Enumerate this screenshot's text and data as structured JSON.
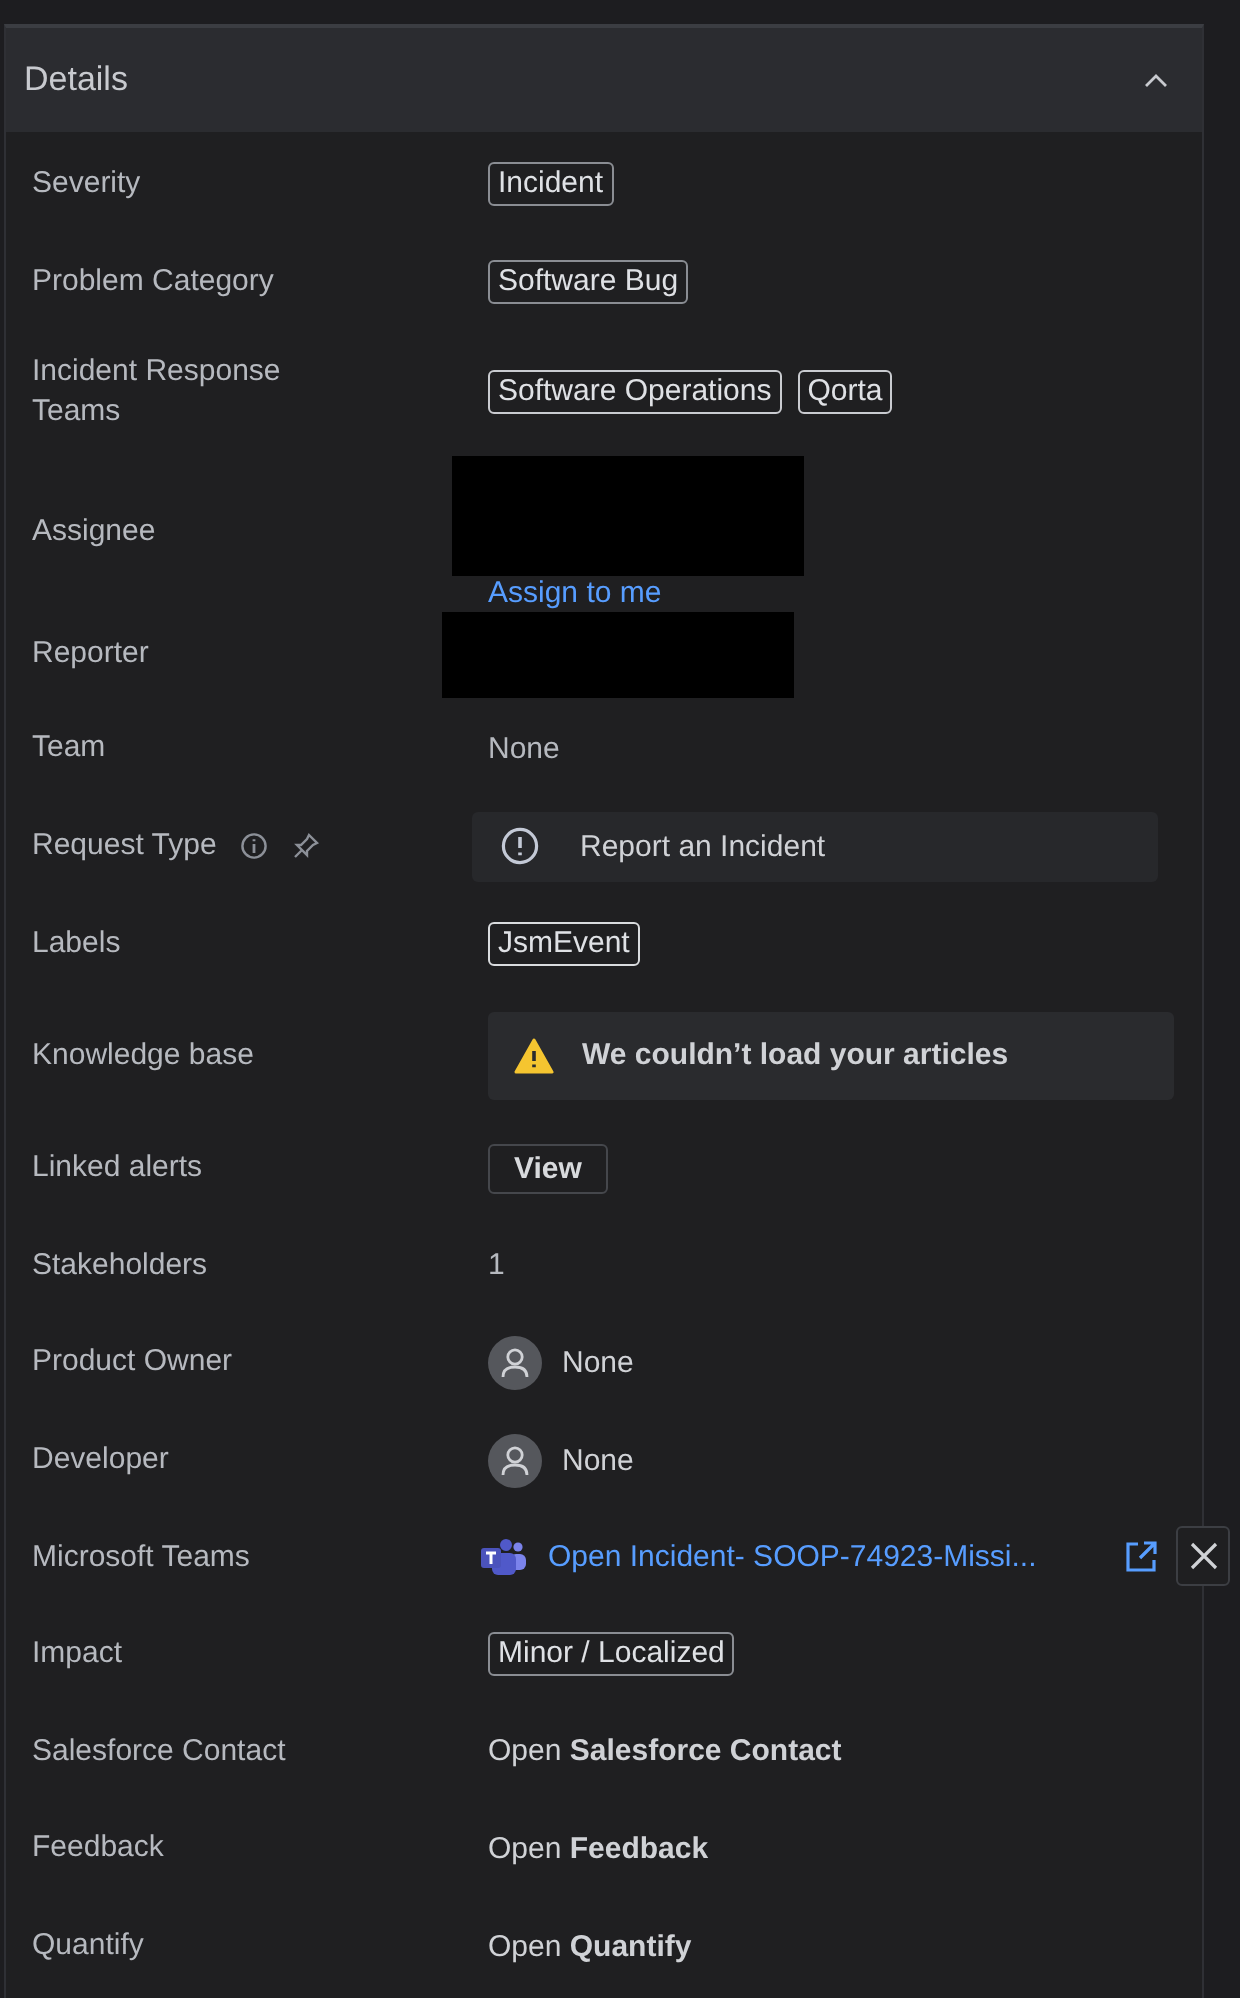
{
  "panel": {
    "title": "Details",
    "expanded": true
  },
  "fields": [
    {
      "label": "Severity",
      "kind": "tags",
      "tags": [
        "Incident"
      ]
    },
    {
      "label": "Problem Category",
      "kind": "tags",
      "tags": [
        "Software Bug"
      ]
    },
    {
      "label": "Incident Response Teams",
      "kind": "tags",
      "tags": [
        "Software Operations",
        "Qorta"
      ]
    },
    {
      "label": "Assignee",
      "kind": "redacted-link",
      "link": "Assign to me"
    },
    {
      "label": "Reporter",
      "kind": "redacted"
    },
    {
      "label": "Team",
      "kind": "text",
      "value": "None"
    },
    {
      "label": "Request Type",
      "kind": "request",
      "value": "Report an Incident"
    },
    {
      "label": "Labels",
      "kind": "tags",
      "tags": [
        "JsmEvent"
      ]
    },
    {
      "label": "Knowledge base",
      "kind": "warning",
      "value": "We couldn’t load your articles"
    },
    {
      "label": "Linked alerts",
      "kind": "button",
      "value": "View"
    },
    {
      "label": "Stakeholders",
      "kind": "text",
      "value": "1"
    },
    {
      "label": "Product Owner",
      "kind": "person",
      "value": "None"
    },
    {
      "label": "Developer",
      "kind": "person",
      "value": "None"
    },
    {
      "label": "Microsoft Teams",
      "kind": "teams",
      "value": "Open Incident- SOOP-74923-Missi..."
    },
    {
      "label": "Impact",
      "kind": "tags",
      "tags": [
        "Minor / Localized"
      ]
    },
    {
      "label": "Salesforce Contact",
      "kind": "open",
      "value": "Open **Salesforce Contact**"
    },
    {
      "label": "Feedback",
      "kind": "open",
      "value": "Open **Feedback**"
    },
    {
      "label": "Quantify",
      "kind": "open",
      "value": "Open **Quantify**"
    }
  ]
}
